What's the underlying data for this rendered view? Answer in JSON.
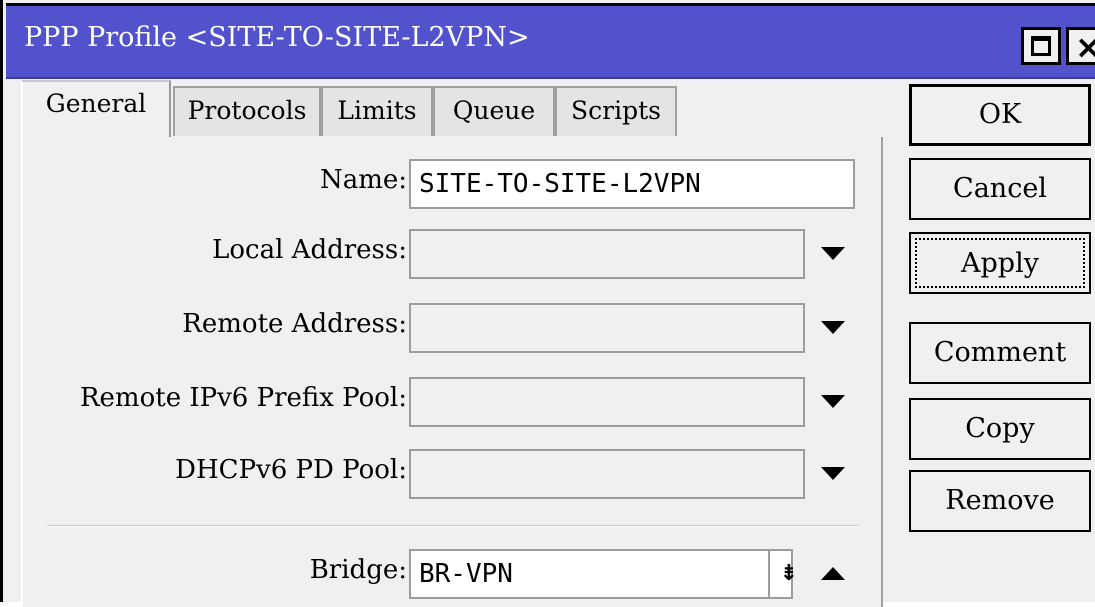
{
  "window": {
    "title": "PPP Profile <SITE-TO-SITE-L2VPN>",
    "maximize_icon": "maximize-icon",
    "close_glyph": "×",
    "title_bar_color": "#5252cc"
  },
  "tabs": [
    {
      "label": "General"
    },
    {
      "label": "Protocols"
    },
    {
      "label": "Limits"
    },
    {
      "label": "Queue"
    },
    {
      "label": "Scripts"
    }
  ],
  "form": {
    "name": {
      "label": "Name:",
      "value": "SITE-TO-SITE-L2VPN"
    },
    "local_address": {
      "label": "Local Address:",
      "value": ""
    },
    "remote_address": {
      "label": "Remote Address:",
      "value": ""
    },
    "remote_ipv6_prefix_pool": {
      "label": "Remote IPv6 Prefix Pool:",
      "value": ""
    },
    "dhcpv6_pd_pool": {
      "label": "DHCPv6 PD Pool:",
      "value": ""
    },
    "bridge": {
      "label": "Bridge:",
      "value": "BR-VPN",
      "pick_glyph": "⇟"
    }
  },
  "buttons": {
    "ok": "OK",
    "cancel": "Cancel",
    "apply": "Apply",
    "comment": "Comment",
    "copy": "Copy",
    "remove": "Remove"
  }
}
